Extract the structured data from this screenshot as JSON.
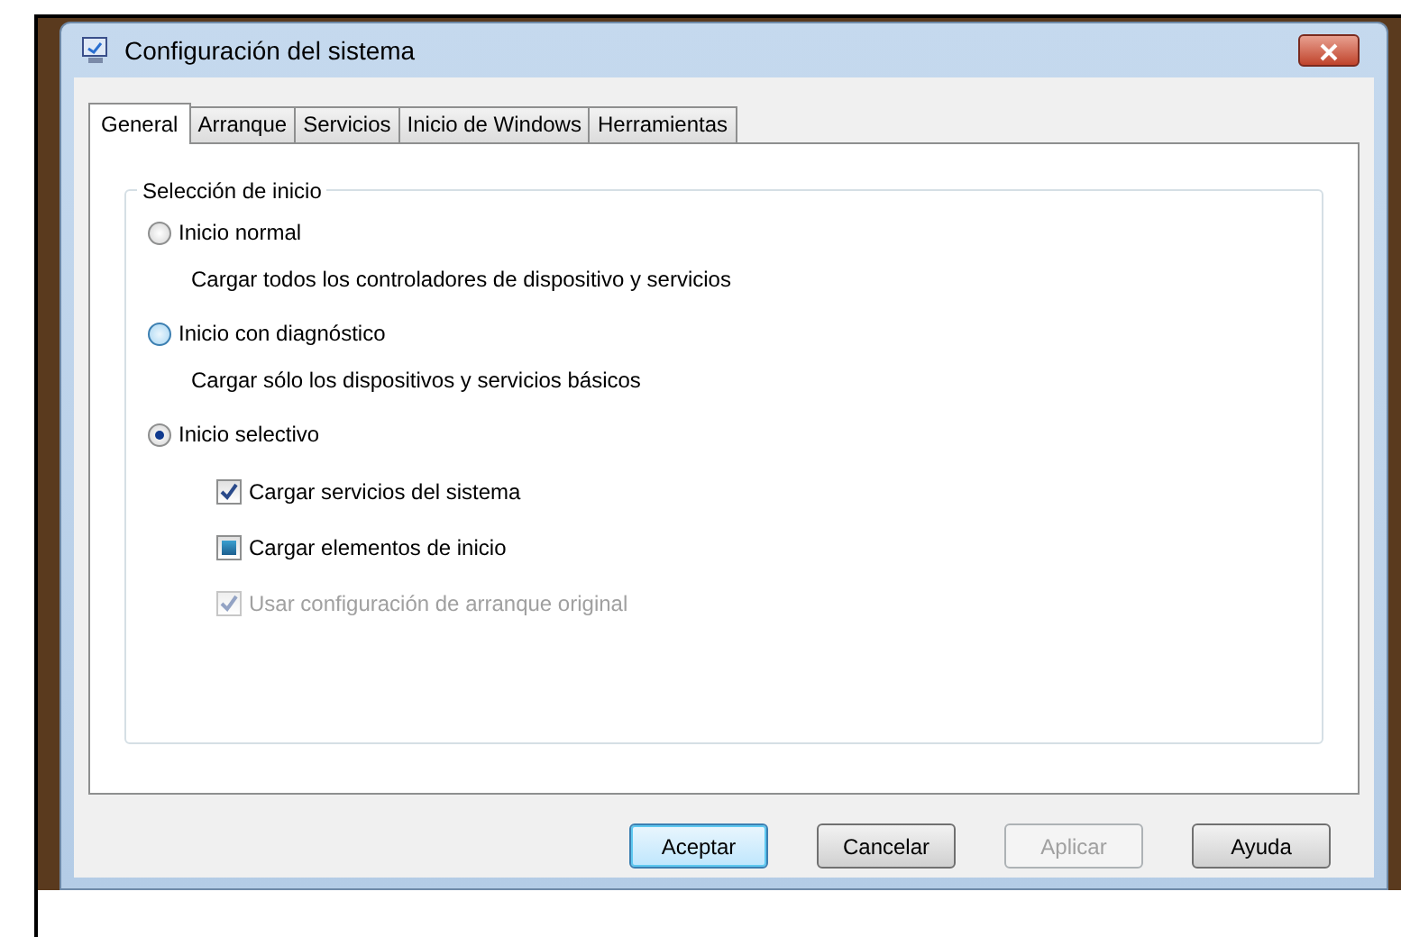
{
  "window": {
    "title": "Configuración del sistema"
  },
  "tabs": [
    {
      "label": "General",
      "selected": true
    },
    {
      "label": "Arranque",
      "selected": false
    },
    {
      "label": "Servicios",
      "selected": false
    },
    {
      "label": "Inicio de Windows",
      "selected": false
    },
    {
      "label": "Herramientas",
      "selected": false
    }
  ],
  "group": {
    "title": "Selección de inicio",
    "options": [
      {
        "label": "Inicio normal",
        "selected": false,
        "description": "Cargar todos los controladores de dispositivo y servicios"
      },
      {
        "label": "Inicio con diagnóstico",
        "selected": false,
        "hover": true,
        "description": "Cargar sólo los dispositivos y servicios básicos"
      },
      {
        "label": "Inicio selectivo",
        "selected": true,
        "checkboxes": [
          {
            "label": "Cargar servicios del sistema",
            "checked": true,
            "mixed": false,
            "disabled": false
          },
          {
            "label": "Cargar elementos de inicio",
            "checked": false,
            "mixed": true,
            "disabled": false
          },
          {
            "label": "Usar configuración de arranque original",
            "checked": true,
            "mixed": false,
            "disabled": true
          }
        ]
      }
    ]
  },
  "buttons": [
    {
      "label": "Aceptar",
      "default": true,
      "disabled": false
    },
    {
      "label": "Cancelar",
      "default": false,
      "disabled": false
    },
    {
      "label": "Aplicar",
      "default": false,
      "disabled": true
    },
    {
      "label": "Ayuda",
      "default": false,
      "disabled": false
    }
  ]
}
